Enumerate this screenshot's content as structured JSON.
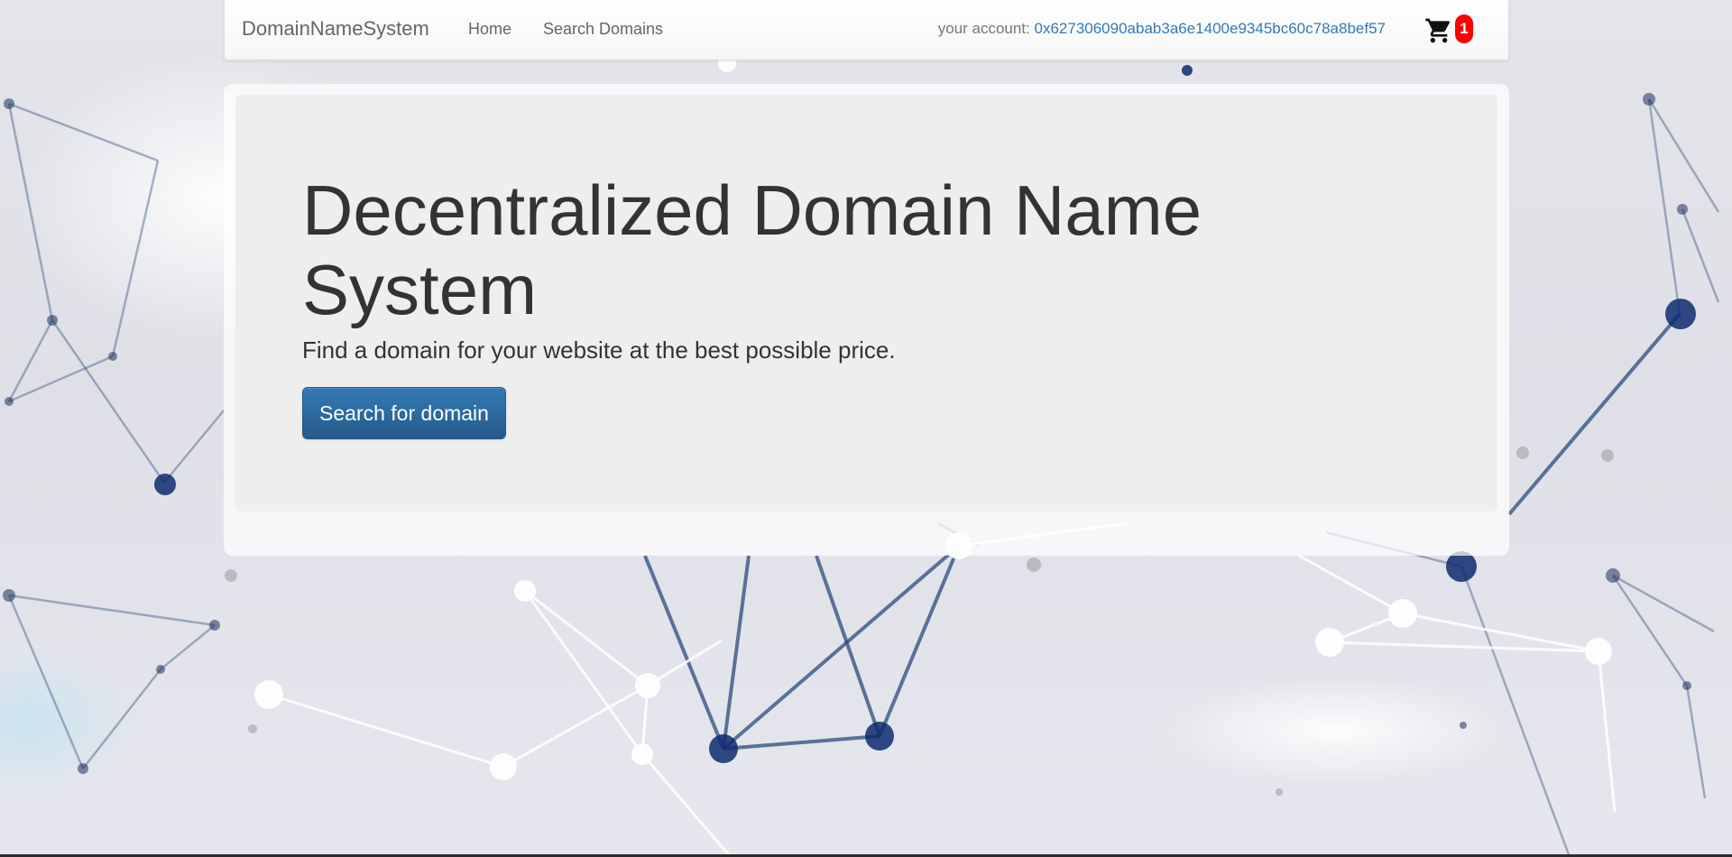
{
  "navbar": {
    "brand": "DomainNameSystem",
    "links": [
      {
        "label": "Home"
      },
      {
        "label": "Search Domains"
      }
    ],
    "account_label": "your account: ",
    "account_address": "0x627306090abab3a6e1400e9345bc60c78a8bef57",
    "cart_icon": "shopping-cart-icon",
    "cart_count": "1"
  },
  "hero": {
    "title": "Decentralized Domain Name System",
    "subtitle": "Find a domain for your website at the best possible price.",
    "button_label": "Search for domain"
  },
  "colors": {
    "link": "#337ab7",
    "button_top": "#337ab7",
    "button_bottom": "#265a88",
    "badge": "#ff0000",
    "jumbotron": "#eeeeee"
  }
}
